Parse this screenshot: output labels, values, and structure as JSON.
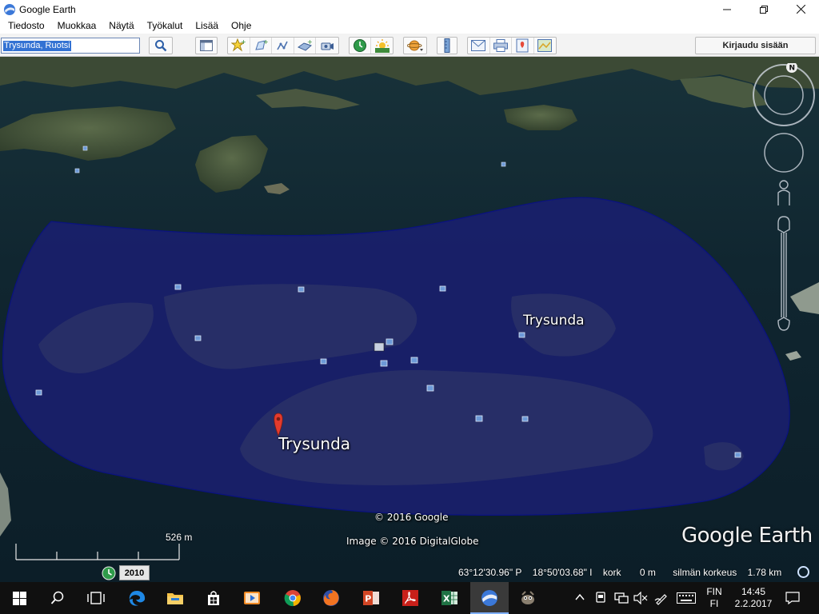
{
  "window": {
    "title": "Google Earth",
    "minimize_icon": "minimize-icon",
    "maximize_icon": "restore-icon",
    "close_icon": "close-icon"
  },
  "menu": {
    "items": [
      "Tiedosto",
      "Muokkaa",
      "Näytä",
      "Työkalut",
      "Lisää",
      "Ohje"
    ]
  },
  "toolbar": {
    "search_value": "Trysunda, Ruotsi",
    "search_button_icon": "search-icon",
    "login_label": "Kirjaudu sisään",
    "tools": [
      "sidebar-toggle-icon",
      "placemark-icon",
      "polygon-icon",
      "path-icon",
      "image-overlay-icon",
      "record-tour-icon",
      "historical-imagery-icon",
      "sunlight-icon",
      "planet-switch-icon",
      "ruler-icon",
      "email-icon",
      "print-icon",
      "save-image-icon",
      "view-in-maps-icon"
    ]
  },
  "map": {
    "labels": {
      "place_main": "Trysunda",
      "place_secondary": "Trysunda",
      "attribution_google": "© 2016 Google",
      "attribution_image": "Image © 2016 DigitalGlobe",
      "logo": "Google Earth"
    },
    "scale": {
      "label": "526 m"
    },
    "history": {
      "year": "2010"
    },
    "status": {
      "latitude": "63°12'30.96\" P",
      "longitude": "18°50'03.68\" I",
      "elevation_label": "kork",
      "elevation_value": "0 m",
      "eye_alt_label": "silmän korkeus",
      "eye_alt_value": "1.78 km"
    },
    "compass_letter": "N",
    "colors": {
      "polygon_fill": "#1a1f6e",
      "polygon_stroke": "#0a1280",
      "water": "#0f2630",
      "land": "#34442e",
      "pin": "#e43b2d"
    }
  },
  "taskbar": {
    "apps": [
      "windows-start-icon",
      "search-icon",
      "task-view-icon",
      "edge-icon",
      "file-explorer-icon",
      "store-icon",
      "media-icon",
      "chrome-icon",
      "firefox-icon",
      "powerpoint-icon",
      "acrobat-icon",
      "excel-icon",
      "google-earth-icon",
      "gimp-icon"
    ],
    "language_top": "FIN",
    "language_bottom": "FI",
    "time": "14:45",
    "date": "2.2.2017"
  }
}
